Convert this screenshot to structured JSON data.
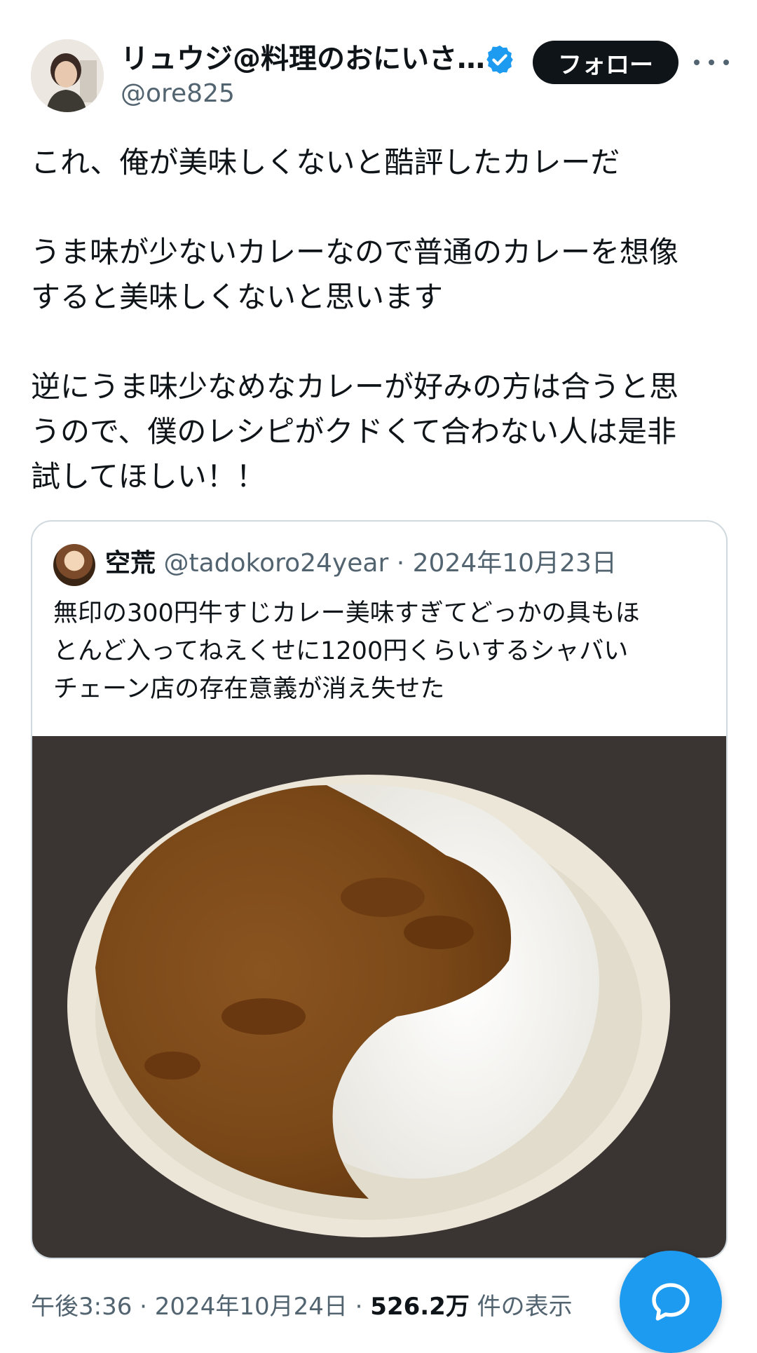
{
  "author": {
    "display_name": "リュウジ@料理のおにいさ…",
    "handle": "@ore825",
    "avatar_icon": "user-avatar",
    "verified_icon": "verified-badge-icon",
    "verified_color": "#1d9bf0"
  },
  "header": {
    "follow_label": "フォロー",
    "more_icon": "more-icon"
  },
  "tweet": {
    "lines": [
      "これ、俺が美味しくないと酷評したカレーだ",
      "",
      "うま味が少ないカレーなので普通のカレーを想像",
      "すると美味しくないと思います",
      "",
      "逆にうま味少なめなカレーが好みの方は合うと思",
      "うので、僕のレシピがクドくて合わない人は是非",
      "試してほしい！！"
    ]
  },
  "quote": {
    "name": "空荒",
    "handle": "@tadokoro24year",
    "separator": "·",
    "date": "2024年10月23日",
    "lines": [
      "無印の300円牛すじカレー美味すぎてどっかの具もほ",
      "とんど入ってねえくせに1200円くらいするシャバい",
      "チェーン店の存在意義が消え失せた"
    ],
    "photo": "curry-rice-photo"
  },
  "footer": {
    "time": "午後3:36",
    "sep1": "·",
    "date": "2024年10月24日",
    "sep2": "·",
    "views": "526.2万",
    "views_label": "件の表示"
  },
  "fab": {
    "icon": "reply-bubble-icon",
    "color": "#1d9bf0"
  }
}
